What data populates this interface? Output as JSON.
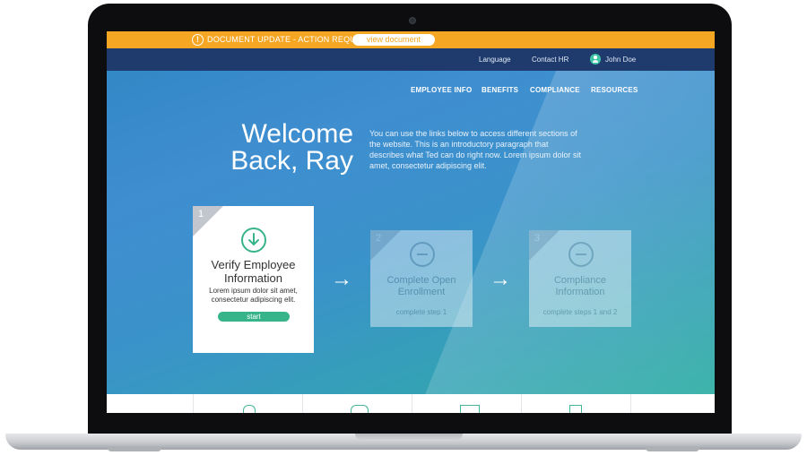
{
  "alert": {
    "icon": "alert-circle-icon",
    "text": "DOCUMENT UPDATE - ACTION REQUIRED",
    "button": "view document",
    "color": "#f5a623"
  },
  "utility": {
    "language": "Language",
    "contact": "Contact HR",
    "user_name": "John Doe",
    "user_icon": "user-avatar-icon"
  },
  "nav": [
    "EMPLOYEE INFO",
    "BENEFITS",
    "COMPLIANCE",
    "RESOURCES"
  ],
  "hero": {
    "line1": "Welcome",
    "line2": "Back, Ray",
    "intro": "You can use the links below to access different sections of the website. This is an introductory paragraph that describes what Ted can do right now. Lorem ipsum dolor sit amet, consectetur adipiscing elit."
  },
  "steps": [
    {
      "number": "1",
      "title1": "Verify Employee",
      "title2": "Information",
      "desc1": "Lorem ipsum dolor sit amet,",
      "desc2": "consectetur adipiscing elit.",
      "button": "start",
      "icon": "download-arrow-icon"
    },
    {
      "number": "2",
      "title1": "Complete Open",
      "title2": "Enrollment",
      "status": "complete step 1",
      "icon": "blocked-icon"
    },
    {
      "number": "3",
      "title1": "Compliance",
      "title2": "Information",
      "status": "complete steps 1 and 2",
      "icon": "blocked-icon"
    }
  ],
  "arrow_glyph": "→",
  "colors": {
    "accent": "#38b48b",
    "header": "#1f3b6e"
  }
}
